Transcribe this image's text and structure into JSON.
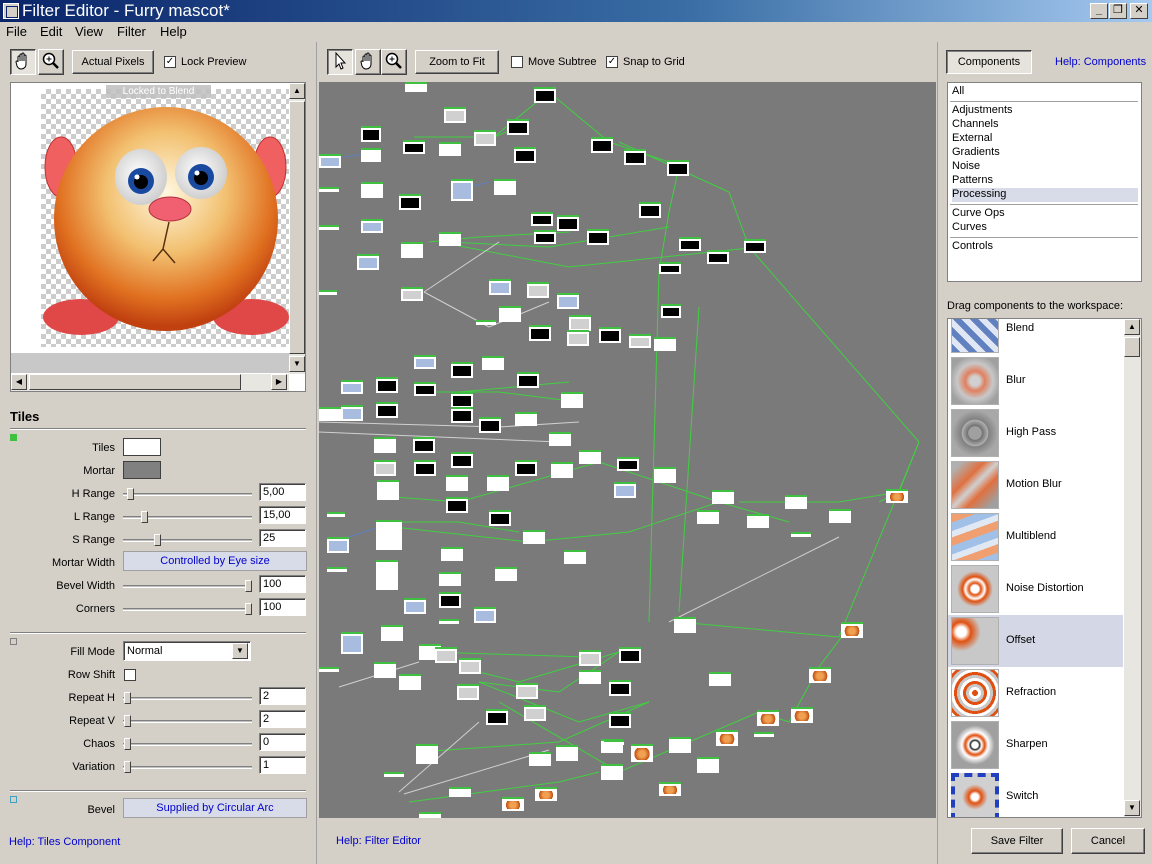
{
  "window": {
    "title": "Filter Editor - Furry mascot*",
    "min": "_",
    "max": "❐",
    "close": "✕"
  },
  "menu": [
    "File",
    "Edit",
    "View",
    "Filter",
    "Help"
  ],
  "left_toolbar": {
    "actual_pixels": "Actual Pixels",
    "lock_preview": "Lock Preview",
    "lock_checked": "✓"
  },
  "preview": {
    "overlay": "Locked to Blend"
  },
  "tiles": {
    "heading": "Tiles",
    "tiles_label": "Tiles",
    "mortar_label": "Mortar",
    "h_range_label": "H Range",
    "h_range": "5,00",
    "l_range_label": "L Range",
    "l_range": "15,00",
    "s_range_label": "S Range",
    "s_range": "25",
    "mortar_width_label": "Mortar Width",
    "mortar_width": "Controlled by Eye size",
    "bevel_width_label": "Bevel Width",
    "bevel_width": "100",
    "corners_label": "Corners",
    "corners": "100",
    "fill_mode_label": "Fill Mode",
    "fill_mode": "Normal",
    "row_shift_label": "Row Shift",
    "repeat_h_label": "Repeat H",
    "repeat_h": "2",
    "repeat_v_label": "Repeat V",
    "repeat_v": "2",
    "chaos_label": "Chaos",
    "chaos": "0",
    "variation_label": "Variation",
    "variation": "1",
    "bevel_label": "Bevel",
    "bevel": "Supplied by Circular Arc",
    "help": "Help: Tiles Component"
  },
  "workspace_toolbar": {
    "zoom_to_fit": "Zoom to Fit",
    "move_subtree": "Move Subtree",
    "snap_to_grid": "Snap to Grid",
    "snap_checked": "✓"
  },
  "workspace_help": "Help: Filter Editor",
  "components": {
    "tab": "Components",
    "help": "Help: Components",
    "categories_a": [
      "All"
    ],
    "categories_b": [
      "Adjustments",
      "Channels",
      "External",
      "Gradients",
      "Noise",
      "Patterns",
      "Processing"
    ],
    "categories_c": [
      "Curve Ops",
      "Curves"
    ],
    "categories_d": [
      "Controls"
    ],
    "drag_hint": "Drag components to the workspace:",
    "items": [
      "Blend",
      "Blur",
      "High Pass",
      "Motion Blur",
      "Multiblend",
      "Noise Distortion",
      "Offset",
      "Refraction",
      "Sharpen",
      "Switch"
    ]
  },
  "buttons": {
    "save": "Save Filter",
    "cancel": "Cancel"
  },
  "colors": {
    "node_header": "#40c040",
    "workspace_bg": "#7a7a7a",
    "selected_bg": "#d8dce8",
    "link": "#0000cc"
  }
}
